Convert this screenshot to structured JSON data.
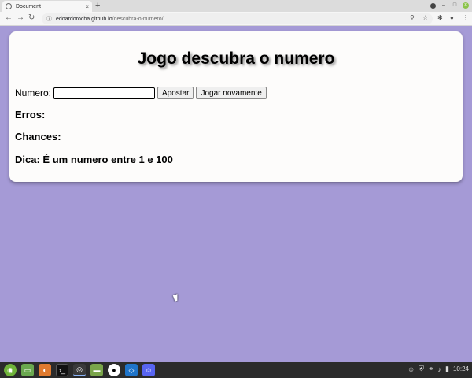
{
  "browser": {
    "tab_title": "Document",
    "tab_close": "×",
    "new_tab": "+",
    "url_domain": "edoardorocha.github.io",
    "url_path": "/descubra-o-numero/",
    "nav_back": "←",
    "nav_forward": "→",
    "nav_reload": "↻",
    "win_minimize": "–",
    "win_maximize": "□",
    "win_close": "×"
  },
  "page": {
    "title": "Jogo descubra o numero",
    "number_label": "Numero:",
    "number_value": "",
    "bet_button": "Apostar",
    "replay_button": "Jogar novamente",
    "errors_label": "Erros:",
    "errors_value": "",
    "chances_label": "Chances:",
    "chances_value": "",
    "hint_label": "Dica:",
    "hint_value": "É um numero entre 1 e 100"
  },
  "taskbar": {
    "clock": "10:24"
  },
  "colors": {
    "background": "#a59ad6",
    "card": "#fdfcfb"
  }
}
